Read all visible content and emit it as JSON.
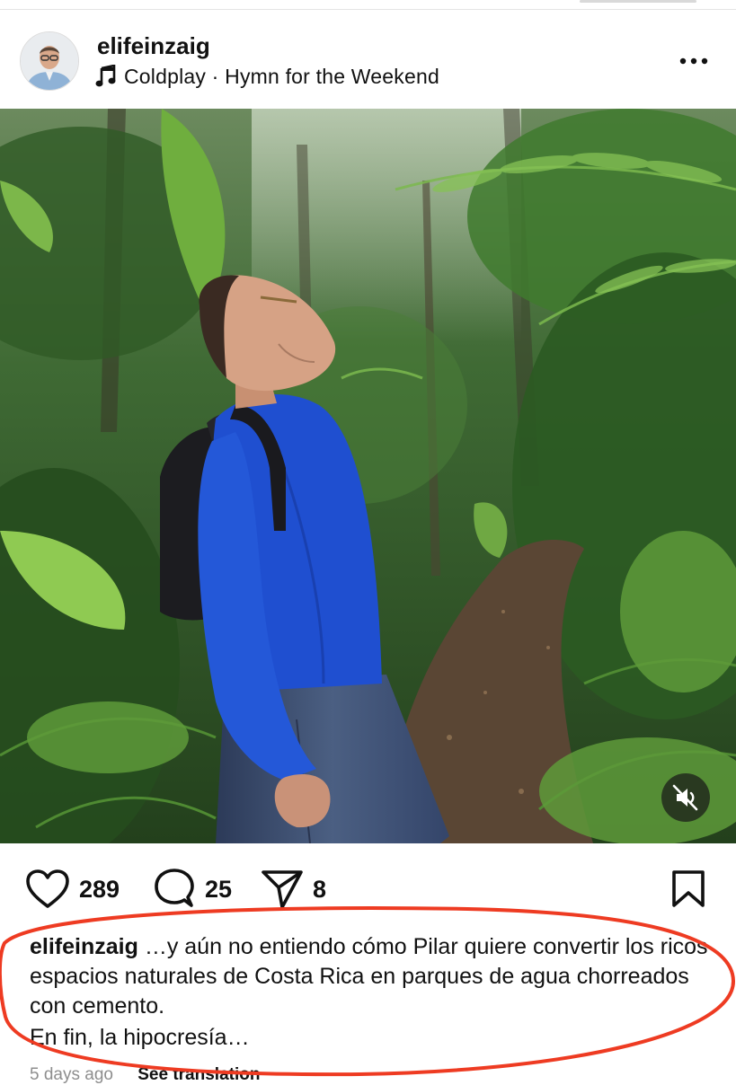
{
  "post": {
    "username": "elifeinzaig",
    "music": "Coldplay · Hymn for the Weekend"
  },
  "actions": {
    "likes": "289",
    "comments": "25",
    "shares": "8"
  },
  "caption": {
    "username": "elifeinzaig",
    "text": "…y aún no entiendo cómo Pilar quiere convertir los ricos espacios naturales de Costa Rica en parques de agua chorreados con cemento.",
    "text_line2": "En fin, la hipocresía…"
  },
  "meta": {
    "time": "5 days ago",
    "translation": "See translation"
  },
  "icons": {
    "music": "music-note-icon",
    "more": "more-options-icon",
    "like": "heart-icon",
    "comment": "comment-bubble-icon",
    "share": "send-arrow-icon",
    "save": "bookmark-icon",
    "mute": "speaker-muted-icon"
  },
  "colors": {
    "annotation_oval": "#ee3b22",
    "meta_text": "#8e8e8e",
    "shirt_blue": "#1f4fd0"
  }
}
